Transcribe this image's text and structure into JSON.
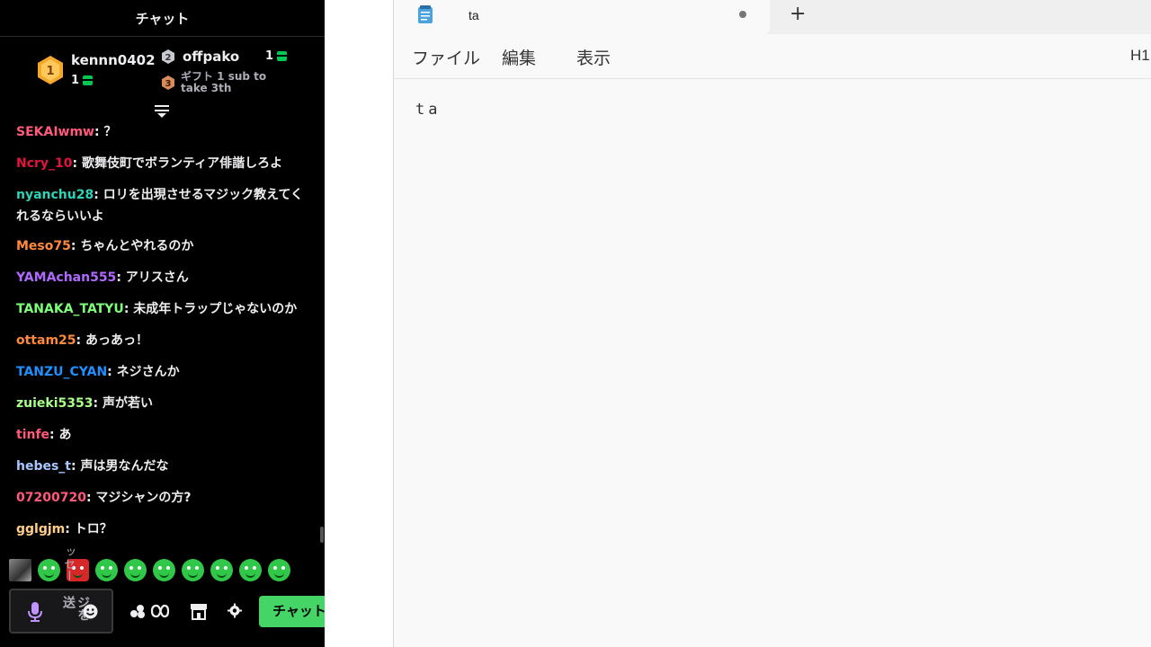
{
  "chat": {
    "title": "チャット",
    "leaderboard": {
      "first": {
        "rank": "1",
        "name": "kennn0402",
        "count": "1"
      },
      "second": {
        "rank": "2",
        "name": "offpako",
        "count": "1"
      },
      "third": {
        "rank": "3",
        "text": "ギフト 1 sub to take 3th"
      }
    },
    "messages": [
      {
        "user": "SEKAIwmw",
        "color": "#ff5a7a",
        "text": ": ？"
      },
      {
        "user": "Ncry_10",
        "color": "#e3143c",
        "text": ": 歌舞伎町でボランティア俳諧しろよ"
      },
      {
        "user": "nyanchu28",
        "color": "#2fd3b6",
        "text": ": ロリを出現させるマジック教えてくれるならいいよ"
      },
      {
        "user": "Meso75",
        "color": "#ff8a3d",
        "text": ": ちゃんとやれるのか"
      },
      {
        "user": "YAMAchan555",
        "color": "#b069ff",
        "text": ": アリスさん"
      },
      {
        "user": "TANAKA_TATYU",
        "color": "#7dff7a",
        "text": ": 未成年トラップじゃないのか"
      },
      {
        "user": "ottam25",
        "color": "#ff8a3d",
        "text": ": あっあっ！"
      },
      {
        "user": "TANZU_CYAN",
        "color": "#1e90ff",
        "text": ": ネジさんか"
      },
      {
        "user": "zuieki5353",
        "color": "#a8ff8a",
        "text": ": 声が若い"
      },
      {
        "user": "tinfe",
        "color": "#ff5a7a",
        "text": ": あ"
      },
      {
        "user": "hebes_t",
        "color": "#a6c8ff",
        "text": ": 声は男なんだな"
      },
      {
        "user": "07200720",
        "color": "#ff5a7a",
        "text": ": マジシャンの方?"
      },
      {
        "user": "gglgjm",
        "color": "#ffcf8a",
        "text": ": トロ？"
      }
    ],
    "input": {
      "placeholder_visible": "ジを送",
      "overflow_text": "ッセー"
    },
    "chat_button": "チャット",
    "accent_color": "#45d466"
  },
  "notepad": {
    "tab_title": "ta",
    "new_tab": "+",
    "menu": {
      "file": "ファイル",
      "edit": "編集",
      "view": "表示"
    },
    "heading_button": "H1",
    "content": "ta"
  }
}
